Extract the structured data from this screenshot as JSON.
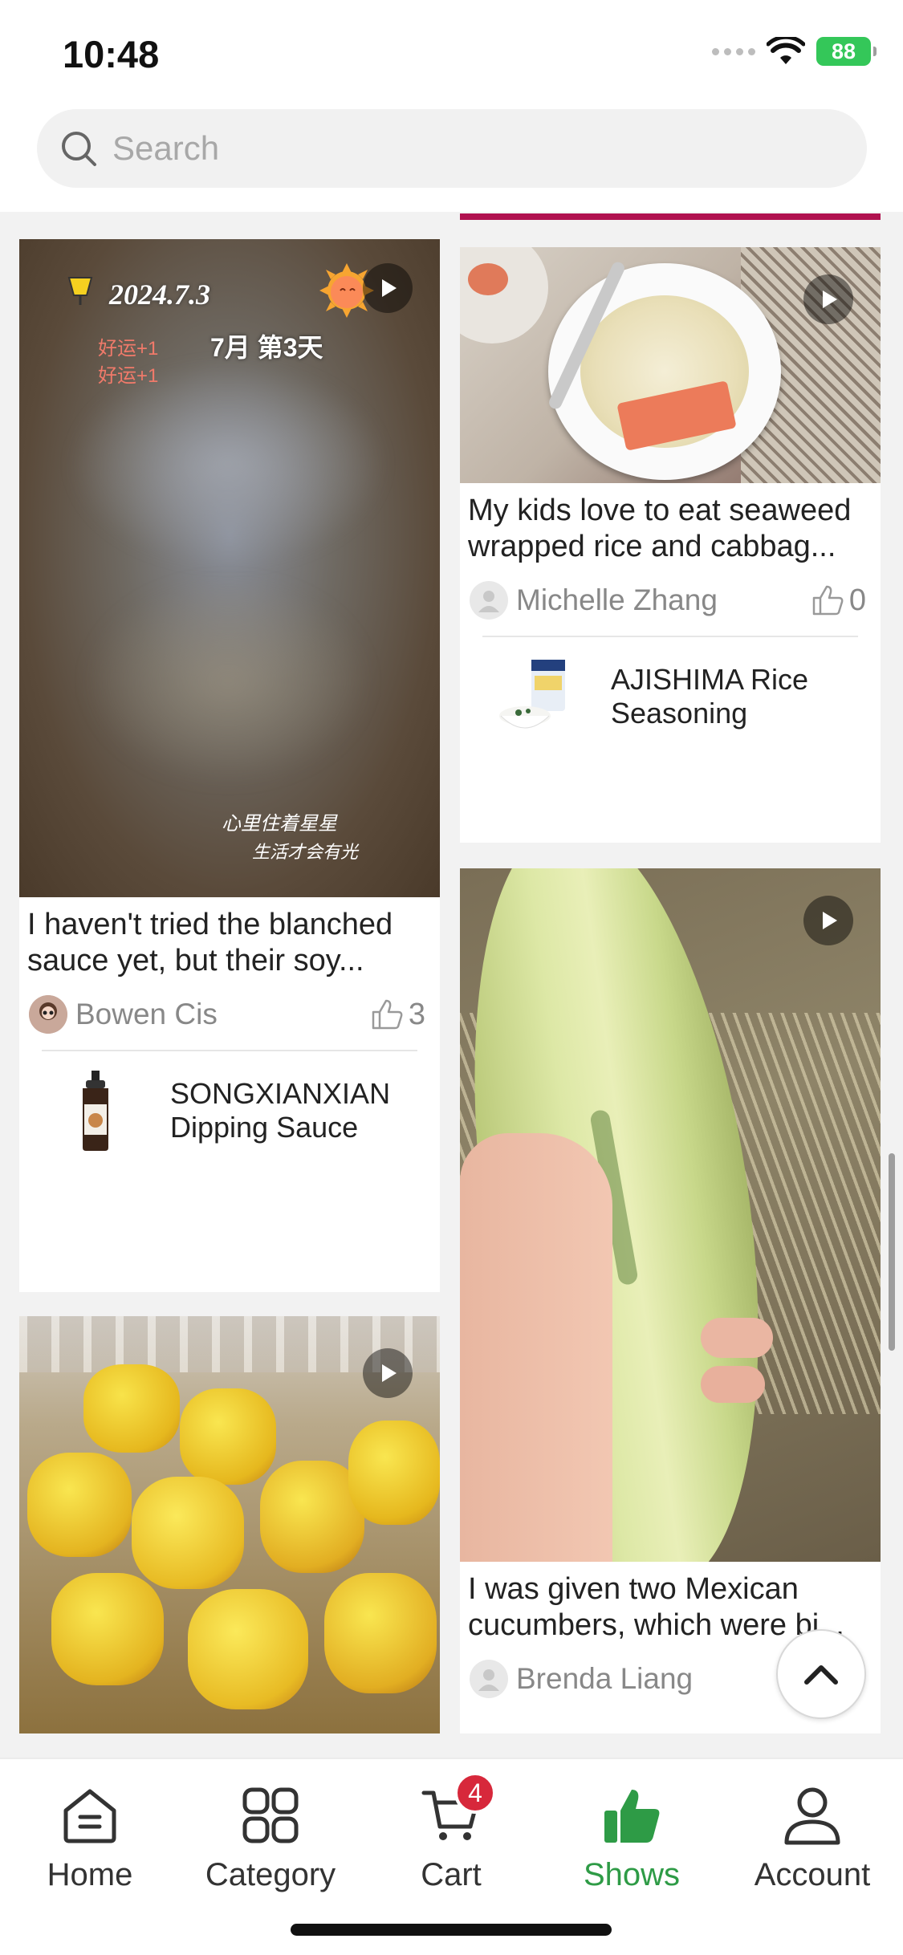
{
  "status_bar": {
    "time": "10:48",
    "battery": "88"
  },
  "search": {
    "placeholder": "Search"
  },
  "feed": {
    "cards": [
      {
        "caption": "2024.7.3",
        "caption2": "7月 第3天",
        "overlay_a": "好运+1",
        "overlay_b": "好运+1",
        "overlay_c": "心里住着星星",
        "overlay_d": "生活才会有光",
        "description": "I haven't tried the blanched sauce yet, but their soy...",
        "author": "Bowen Cis",
        "likes": "3",
        "product": "SONGXIANXIAN Dipping Sauce"
      },
      {
        "description": "My kids love to eat seaweed wrapped rice and cabbag...",
        "author": "Michelle Zhang",
        "likes": "0",
        "product": "AJISHIMA Rice Seasoning"
      },
      {
        "description": "I was given two Mexican cucumbers, which were bi...",
        "author": "Brenda Liang"
      }
    ]
  },
  "tabbar": {
    "tabs": [
      {
        "label": "Home",
        "icon": "home-icon"
      },
      {
        "label": "Category",
        "icon": "category-icon"
      },
      {
        "label": "Cart",
        "icon": "cart-icon",
        "badge": "4"
      },
      {
        "label": "Shows",
        "icon": "thumbs-up-icon",
        "active": true
      },
      {
        "label": "Account",
        "icon": "account-icon"
      }
    ]
  },
  "colors": {
    "accent": "#b0124f",
    "active_tab": "#2e9b46",
    "badge": "#d7283b",
    "battery": "#34c759"
  }
}
